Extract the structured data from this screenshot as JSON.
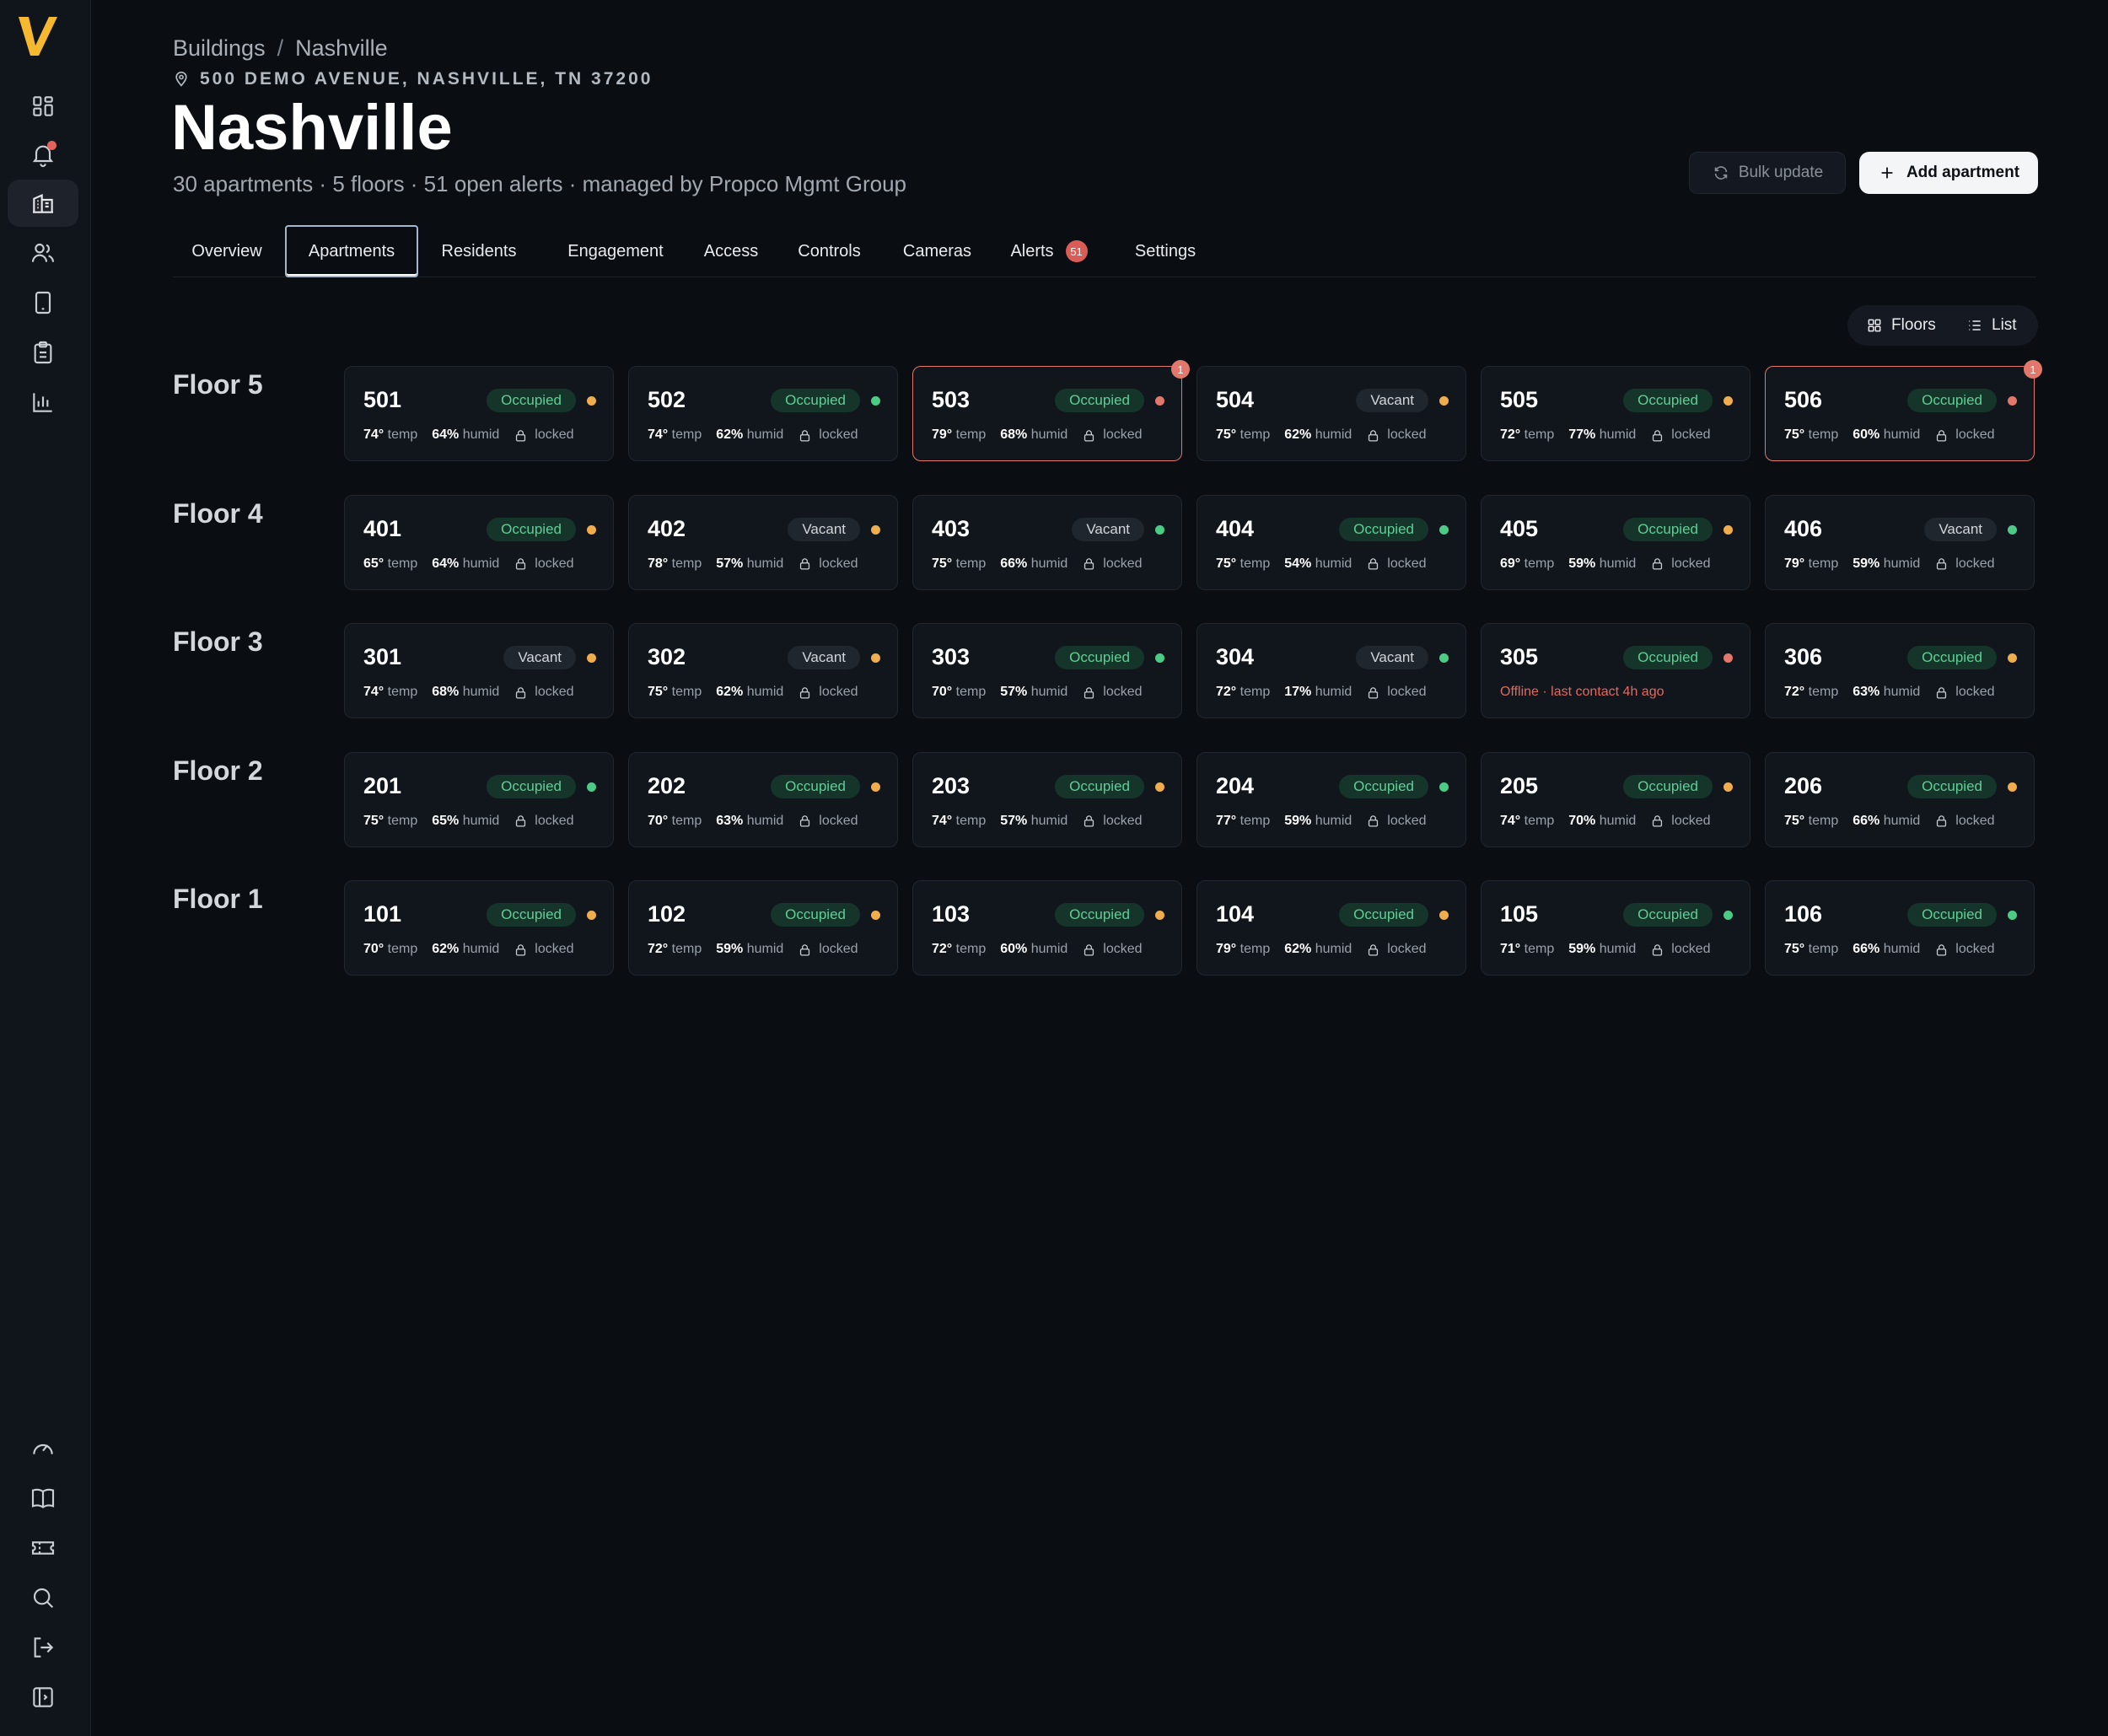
{
  "colors": {
    "accent": "#f5b82e",
    "alert": "#e2776b",
    "ok": "#4ccb86",
    "warn": "#f0ad4e"
  },
  "sidebar": {
    "top_icons": [
      "grid-icon",
      "bell-icon",
      "building-icon",
      "users-icon",
      "device-icon",
      "clipboard-icon",
      "bar-chart-icon"
    ],
    "bottom_icons": [
      "gauge-icon",
      "book-icon",
      "ticket-icon",
      "search-icon",
      "logout-icon",
      "panel-toggle-icon"
    ],
    "active": "building-icon"
  },
  "breadcrumb": {
    "root": "Buildings",
    "separator": "/",
    "current": "Nashville"
  },
  "address": "500 DEMO AVENUE, NASHVILLE, TN 37200",
  "title": "Nashville",
  "subtitle": "30 apartments · 5 floors · 51 open alerts · managed by Propco Mgmt Group",
  "actions": {
    "bulk_update": "Bulk update",
    "add_apartment": "Add apartment"
  },
  "tabs": [
    {
      "label": "Overview"
    },
    {
      "label": "Apartments",
      "active": true
    },
    {
      "label": "Residents"
    },
    {
      "label": "Engagement"
    },
    {
      "label": "Access"
    },
    {
      "label": "Controls"
    },
    {
      "label": "Cameras"
    },
    {
      "label": "Alerts",
      "badge": "51"
    },
    {
      "label": "Settings"
    }
  ],
  "view_toggle": {
    "floors": "Floors",
    "list": "List",
    "selected": "Floors"
  },
  "labels": {
    "temp": "temp",
    "humid": "humid",
    "locked": "locked"
  },
  "floors": [
    {
      "label": "Floor 5",
      "units": [
        {
          "unit": "501",
          "status": "Occupied",
          "dot": "orange",
          "temp": "74°",
          "humid": "64%",
          "lock": "locked"
        },
        {
          "unit": "502",
          "status": "Occupied",
          "dot": "green",
          "temp": "74°",
          "humid": "62%",
          "lock": "locked"
        },
        {
          "unit": "503",
          "status": "Occupied",
          "dot": "red",
          "temp": "79°",
          "humid": "68%",
          "lock": "locked",
          "alerts": "1"
        },
        {
          "unit": "504",
          "status": "Vacant",
          "dot": "orange",
          "temp": "75°",
          "humid": "62%",
          "lock": "locked"
        },
        {
          "unit": "505",
          "status": "Occupied",
          "dot": "orange",
          "temp": "72°",
          "humid": "77%",
          "lock": "locked"
        },
        {
          "unit": "506",
          "status": "Occupied",
          "dot": "red",
          "temp": "75°",
          "humid": "60%",
          "lock": "locked",
          "alerts": "1"
        }
      ]
    },
    {
      "label": "Floor 4",
      "units": [
        {
          "unit": "401",
          "status": "Occupied",
          "dot": "orange",
          "temp": "65°",
          "humid": "64%",
          "lock": "locked"
        },
        {
          "unit": "402",
          "status": "Vacant",
          "dot": "orange",
          "temp": "78°",
          "humid": "57%",
          "lock": "locked"
        },
        {
          "unit": "403",
          "status": "Vacant",
          "dot": "green",
          "temp": "75°",
          "humid": "66%",
          "lock": "locked"
        },
        {
          "unit": "404",
          "status": "Occupied",
          "dot": "green",
          "temp": "75°",
          "humid": "54%",
          "lock": "locked"
        },
        {
          "unit": "405",
          "status": "Occupied",
          "dot": "orange",
          "temp": "69°",
          "humid": "59%",
          "lock": "locked"
        },
        {
          "unit": "406",
          "status": "Vacant",
          "dot": "green",
          "temp": "79°",
          "humid": "59%",
          "lock": "locked"
        }
      ]
    },
    {
      "label": "Floor 3",
      "units": [
        {
          "unit": "301",
          "status": "Vacant",
          "dot": "orange",
          "temp": "74°",
          "humid": "68%",
          "lock": "locked"
        },
        {
          "unit": "302",
          "status": "Vacant",
          "dot": "orange",
          "temp": "75°",
          "humid": "62%",
          "lock": "locked"
        },
        {
          "unit": "303",
          "status": "Occupied",
          "dot": "green",
          "temp": "70°",
          "humid": "57%",
          "lock": "locked"
        },
        {
          "unit": "304",
          "status": "Vacant",
          "dot": "green",
          "temp": "72°",
          "humid": "17%",
          "lock": "locked"
        },
        {
          "unit": "305",
          "status": "Occupied",
          "dot": "red",
          "offline": "Offline · last contact 4h ago"
        },
        {
          "unit": "306",
          "status": "Occupied",
          "dot": "orange",
          "temp": "72°",
          "humid": "63%",
          "lock": "locked"
        }
      ]
    },
    {
      "label": "Floor 2",
      "units": [
        {
          "unit": "201",
          "status": "Occupied",
          "dot": "green",
          "temp": "75°",
          "humid": "65%",
          "lock": "locked"
        },
        {
          "unit": "202",
          "status": "Occupied",
          "dot": "orange",
          "temp": "70°",
          "humid": "63%",
          "lock": "locked"
        },
        {
          "unit": "203",
          "status": "Occupied",
          "dot": "orange",
          "temp": "74°",
          "humid": "57%",
          "lock": "locked"
        },
        {
          "unit": "204",
          "status": "Occupied",
          "dot": "green",
          "temp": "77°",
          "humid": "59%",
          "lock": "locked"
        },
        {
          "unit": "205",
          "status": "Occupied",
          "dot": "orange",
          "temp": "74°",
          "humid": "70%",
          "lock": "locked"
        },
        {
          "unit": "206",
          "status": "Occupied",
          "dot": "orange",
          "temp": "75°",
          "humid": "66%",
          "lock": "locked"
        }
      ]
    },
    {
      "label": "Floor 1",
      "units": [
        {
          "unit": "101",
          "status": "Occupied",
          "dot": "orange",
          "temp": "70°",
          "humid": "62%",
          "lock": "locked"
        },
        {
          "unit": "102",
          "status": "Occupied",
          "dot": "orange",
          "temp": "72°",
          "humid": "59%",
          "lock": "locked"
        },
        {
          "unit": "103",
          "status": "Occupied",
          "dot": "orange",
          "temp": "72°",
          "humid": "60%",
          "lock": "locked"
        },
        {
          "unit": "104",
          "status": "Occupied",
          "dot": "orange",
          "temp": "79°",
          "humid": "62%",
          "lock": "locked"
        },
        {
          "unit": "105",
          "status": "Occupied",
          "dot": "green",
          "temp": "71°",
          "humid": "59%",
          "lock": "locked"
        },
        {
          "unit": "106",
          "status": "Occupied",
          "dot": "green",
          "temp": "75°",
          "humid": "66%",
          "lock": "locked"
        }
      ]
    }
  ]
}
